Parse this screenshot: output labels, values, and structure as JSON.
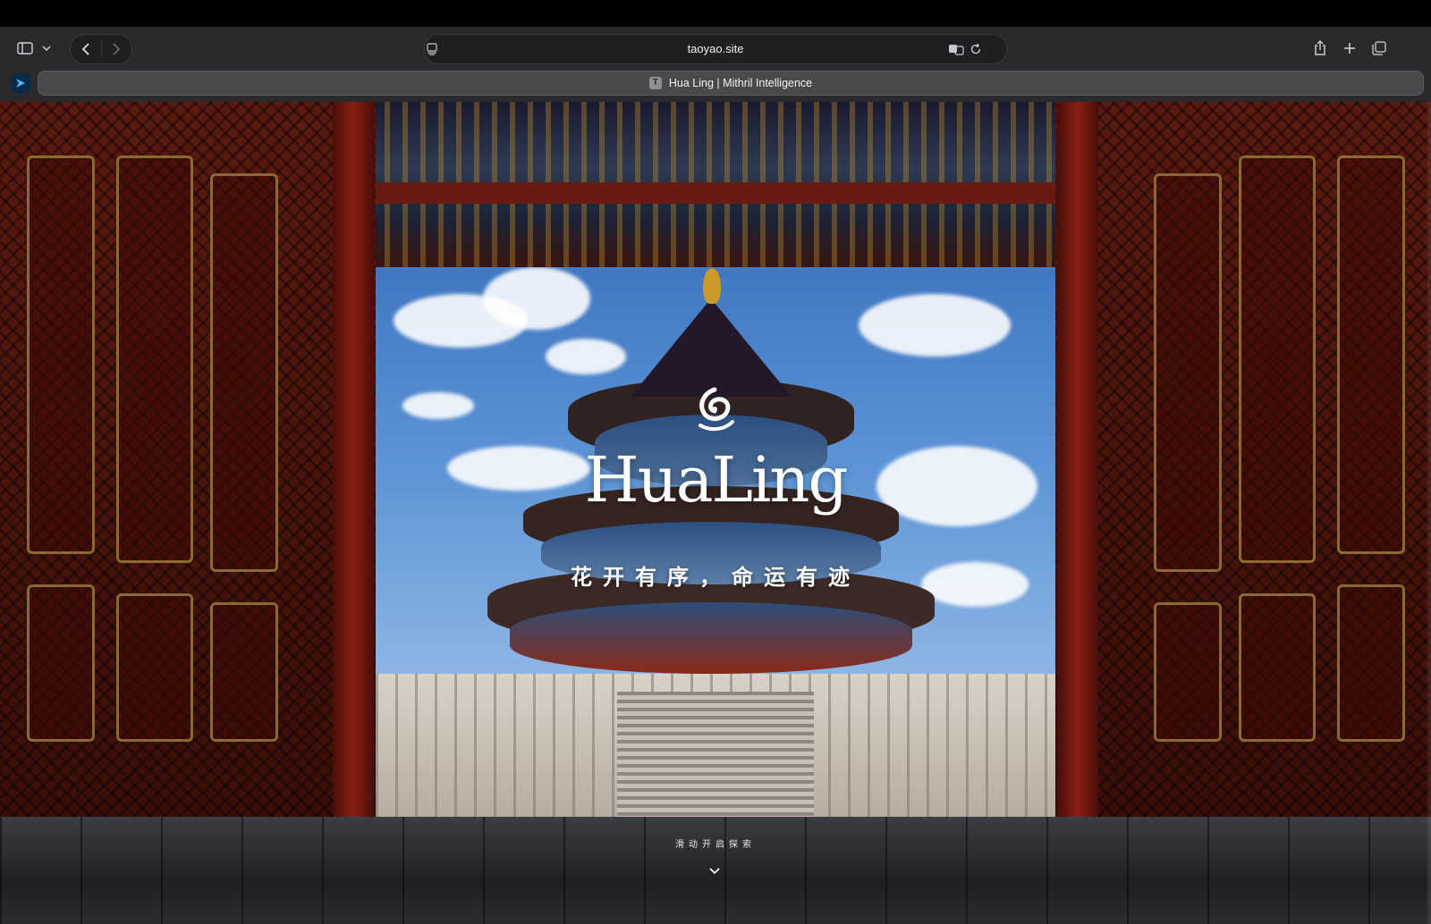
{
  "browser": {
    "url": "taoyao.site",
    "tab_title": "Hua Ling | Mithril Intelligence",
    "tab_favicon_letter": "T",
    "icons": [
      "sidebar-icon",
      "chevron-down-icon",
      "back-icon",
      "forward-icon",
      "reader-icon",
      "translate-icon",
      "reload-icon",
      "share-icon",
      "new-tab-icon",
      "tab-overview-icon",
      "extension-icon"
    ]
  },
  "hero": {
    "brand": "HuaLing",
    "slogan": "花开有序，命运有迹",
    "scroll_hint": "滑动开启探索",
    "scroll_icon": "chevron-down-icon"
  },
  "colors": {
    "chrome_bg": "#2a2a2c",
    "tab_active": "#4a4a4d",
    "door_red": "#5a1a10",
    "gold": "#8a6a30"
  }
}
